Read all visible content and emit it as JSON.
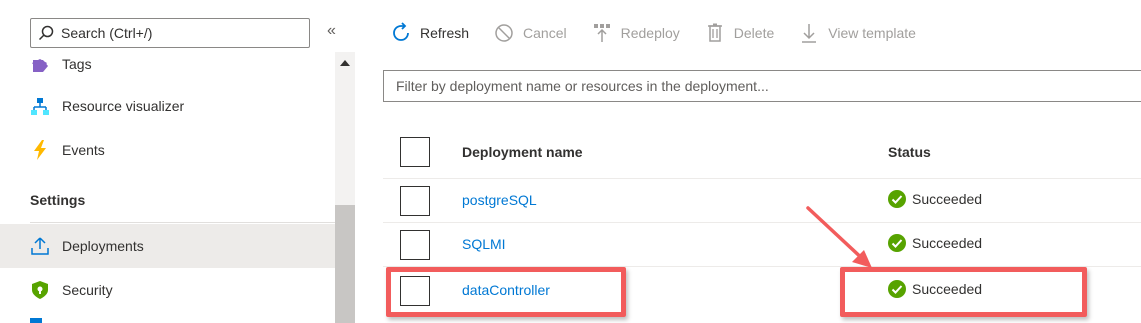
{
  "sidebar": {
    "search_placeholder": "Search (Ctrl+/)",
    "collapse_glyph": "«",
    "items": [
      {
        "label": "Tags",
        "icon": "tag-icon"
      },
      {
        "label": "Resource visualizer",
        "icon": "resource-visualizer-icon"
      },
      {
        "label": "Events",
        "icon": "lightning-icon"
      }
    ],
    "section_title": "Settings",
    "settings_items": [
      {
        "label": "Deployments",
        "icon": "upload-icon",
        "active": true
      },
      {
        "label": "Security",
        "icon": "shield-icon"
      }
    ]
  },
  "toolbar": {
    "refresh": "Refresh",
    "cancel": "Cancel",
    "redeploy": "Redeploy",
    "delete": "Delete",
    "view_template": "View template"
  },
  "filter": {
    "placeholder": "Filter by deployment name or resources in the deployment..."
  },
  "table": {
    "headers": {
      "name": "Deployment name",
      "status": "Status"
    },
    "rows": [
      {
        "name": "postgreSQL",
        "status": "Succeeded"
      },
      {
        "name": "SQLMI",
        "status": "Succeeded"
      },
      {
        "name": "dataController",
        "status": "Succeeded"
      }
    ]
  },
  "colors": {
    "link": "#0078d4",
    "success": "#57a300",
    "highlight": "#f25c5c",
    "active_bg": "#edebe9"
  }
}
